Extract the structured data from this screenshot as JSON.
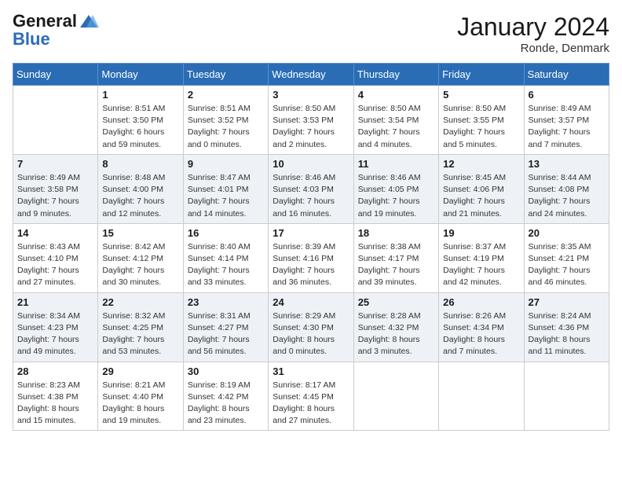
{
  "header": {
    "logo_line1": "General",
    "logo_line2": "Blue",
    "month_title": "January 2024",
    "location": "Ronde, Denmark"
  },
  "weekdays": [
    "Sunday",
    "Monday",
    "Tuesday",
    "Wednesday",
    "Thursday",
    "Friday",
    "Saturday"
  ],
  "weeks": [
    [
      {
        "day": "",
        "sunrise": "",
        "sunset": "",
        "daylight": ""
      },
      {
        "day": "1",
        "sunrise": "Sunrise: 8:51 AM",
        "sunset": "Sunset: 3:50 PM",
        "daylight": "Daylight: 6 hours and 59 minutes."
      },
      {
        "day": "2",
        "sunrise": "Sunrise: 8:51 AM",
        "sunset": "Sunset: 3:52 PM",
        "daylight": "Daylight: 7 hours and 0 minutes."
      },
      {
        "day": "3",
        "sunrise": "Sunrise: 8:50 AM",
        "sunset": "Sunset: 3:53 PM",
        "daylight": "Daylight: 7 hours and 2 minutes."
      },
      {
        "day": "4",
        "sunrise": "Sunrise: 8:50 AM",
        "sunset": "Sunset: 3:54 PM",
        "daylight": "Daylight: 7 hours and 4 minutes."
      },
      {
        "day": "5",
        "sunrise": "Sunrise: 8:50 AM",
        "sunset": "Sunset: 3:55 PM",
        "daylight": "Daylight: 7 hours and 5 minutes."
      },
      {
        "day": "6",
        "sunrise": "Sunrise: 8:49 AM",
        "sunset": "Sunset: 3:57 PM",
        "daylight": "Daylight: 7 hours and 7 minutes."
      }
    ],
    [
      {
        "day": "7",
        "sunrise": "Sunrise: 8:49 AM",
        "sunset": "Sunset: 3:58 PM",
        "daylight": "Daylight: 7 hours and 9 minutes."
      },
      {
        "day": "8",
        "sunrise": "Sunrise: 8:48 AM",
        "sunset": "Sunset: 4:00 PM",
        "daylight": "Daylight: 7 hours and 12 minutes."
      },
      {
        "day": "9",
        "sunrise": "Sunrise: 8:47 AM",
        "sunset": "Sunset: 4:01 PM",
        "daylight": "Daylight: 7 hours and 14 minutes."
      },
      {
        "day": "10",
        "sunrise": "Sunrise: 8:46 AM",
        "sunset": "Sunset: 4:03 PM",
        "daylight": "Daylight: 7 hours and 16 minutes."
      },
      {
        "day": "11",
        "sunrise": "Sunrise: 8:46 AM",
        "sunset": "Sunset: 4:05 PM",
        "daylight": "Daylight: 7 hours and 19 minutes."
      },
      {
        "day": "12",
        "sunrise": "Sunrise: 8:45 AM",
        "sunset": "Sunset: 4:06 PM",
        "daylight": "Daylight: 7 hours and 21 minutes."
      },
      {
        "day": "13",
        "sunrise": "Sunrise: 8:44 AM",
        "sunset": "Sunset: 4:08 PM",
        "daylight": "Daylight: 7 hours and 24 minutes."
      }
    ],
    [
      {
        "day": "14",
        "sunrise": "Sunrise: 8:43 AM",
        "sunset": "Sunset: 4:10 PM",
        "daylight": "Daylight: 7 hours and 27 minutes."
      },
      {
        "day": "15",
        "sunrise": "Sunrise: 8:42 AM",
        "sunset": "Sunset: 4:12 PM",
        "daylight": "Daylight: 7 hours and 30 minutes."
      },
      {
        "day": "16",
        "sunrise": "Sunrise: 8:40 AM",
        "sunset": "Sunset: 4:14 PM",
        "daylight": "Daylight: 7 hours and 33 minutes."
      },
      {
        "day": "17",
        "sunrise": "Sunrise: 8:39 AM",
        "sunset": "Sunset: 4:16 PM",
        "daylight": "Daylight: 7 hours and 36 minutes."
      },
      {
        "day": "18",
        "sunrise": "Sunrise: 8:38 AM",
        "sunset": "Sunset: 4:17 PM",
        "daylight": "Daylight: 7 hours and 39 minutes."
      },
      {
        "day": "19",
        "sunrise": "Sunrise: 8:37 AM",
        "sunset": "Sunset: 4:19 PM",
        "daylight": "Daylight: 7 hours and 42 minutes."
      },
      {
        "day": "20",
        "sunrise": "Sunrise: 8:35 AM",
        "sunset": "Sunset: 4:21 PM",
        "daylight": "Daylight: 7 hours and 46 minutes."
      }
    ],
    [
      {
        "day": "21",
        "sunrise": "Sunrise: 8:34 AM",
        "sunset": "Sunset: 4:23 PM",
        "daylight": "Daylight: 7 hours and 49 minutes."
      },
      {
        "day": "22",
        "sunrise": "Sunrise: 8:32 AM",
        "sunset": "Sunset: 4:25 PM",
        "daylight": "Daylight: 7 hours and 53 minutes."
      },
      {
        "day": "23",
        "sunrise": "Sunrise: 8:31 AM",
        "sunset": "Sunset: 4:27 PM",
        "daylight": "Daylight: 7 hours and 56 minutes."
      },
      {
        "day": "24",
        "sunrise": "Sunrise: 8:29 AM",
        "sunset": "Sunset: 4:30 PM",
        "daylight": "Daylight: 8 hours and 0 minutes."
      },
      {
        "day": "25",
        "sunrise": "Sunrise: 8:28 AM",
        "sunset": "Sunset: 4:32 PM",
        "daylight": "Daylight: 8 hours and 3 minutes."
      },
      {
        "day": "26",
        "sunrise": "Sunrise: 8:26 AM",
        "sunset": "Sunset: 4:34 PM",
        "daylight": "Daylight: 8 hours and 7 minutes."
      },
      {
        "day": "27",
        "sunrise": "Sunrise: 8:24 AM",
        "sunset": "Sunset: 4:36 PM",
        "daylight": "Daylight: 8 hours and 11 minutes."
      }
    ],
    [
      {
        "day": "28",
        "sunrise": "Sunrise: 8:23 AM",
        "sunset": "Sunset: 4:38 PM",
        "daylight": "Daylight: 8 hours and 15 minutes."
      },
      {
        "day": "29",
        "sunrise": "Sunrise: 8:21 AM",
        "sunset": "Sunset: 4:40 PM",
        "daylight": "Daylight: 8 hours and 19 minutes."
      },
      {
        "day": "30",
        "sunrise": "Sunrise: 8:19 AM",
        "sunset": "Sunset: 4:42 PM",
        "daylight": "Daylight: 8 hours and 23 minutes."
      },
      {
        "day": "31",
        "sunrise": "Sunrise: 8:17 AM",
        "sunset": "Sunset: 4:45 PM",
        "daylight": "Daylight: 8 hours and 27 minutes."
      },
      {
        "day": "",
        "sunrise": "",
        "sunset": "",
        "daylight": ""
      },
      {
        "day": "",
        "sunrise": "",
        "sunset": "",
        "daylight": ""
      },
      {
        "day": "",
        "sunrise": "",
        "sunset": "",
        "daylight": ""
      }
    ]
  ]
}
